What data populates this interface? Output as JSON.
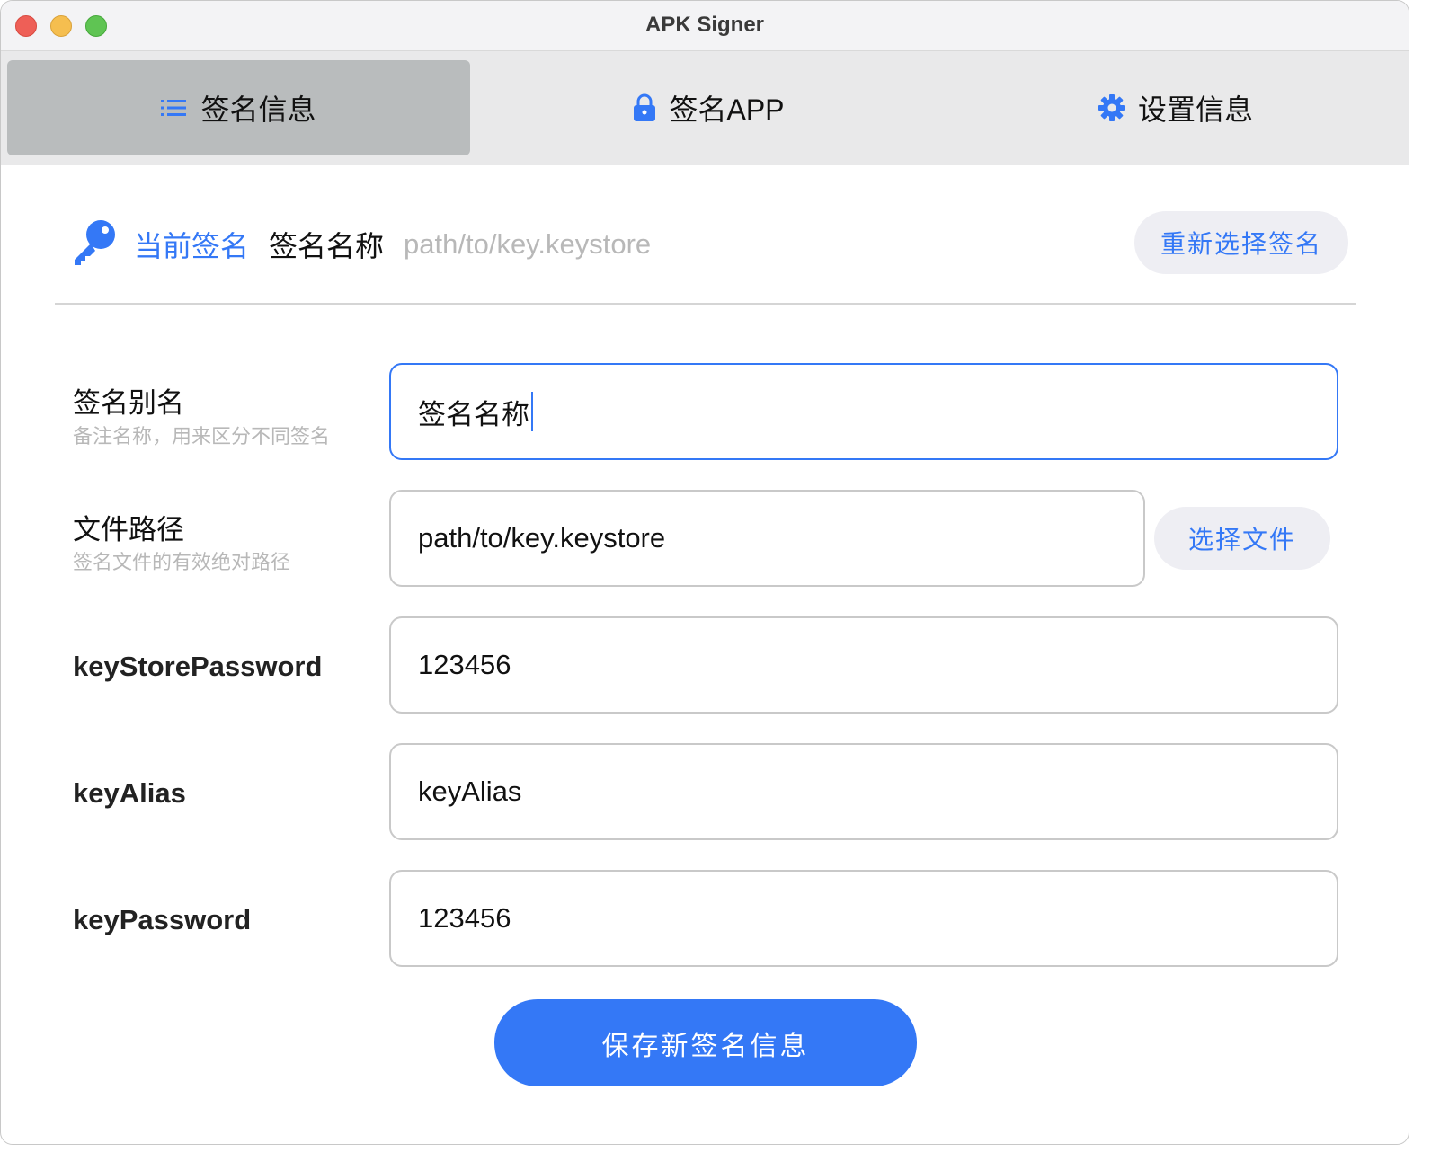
{
  "window": {
    "title": "APK Signer"
  },
  "tabs": [
    {
      "label": "签名信息",
      "icon": "list-icon",
      "active": true
    },
    {
      "label": "签名APP",
      "icon": "lock-icon",
      "active": false
    },
    {
      "label": "设置信息",
      "icon": "gear-icon",
      "active": false
    }
  ],
  "current": {
    "label": "当前签名",
    "name": "签名名称",
    "path": "path/to/key.keystore",
    "reselect_label": "重新选择签名"
  },
  "form": {
    "alias": {
      "label": "签名别名",
      "hint": "备注名称，用来区分不同签名",
      "value": "签名名称",
      "focused": true
    },
    "file": {
      "label": "文件路径",
      "hint": "签名文件的有效绝对路径",
      "value": "path/to/key.keystore",
      "button_label": "选择文件"
    },
    "keystore_password": {
      "label": "keyStorePassword",
      "value": "123456"
    },
    "key_alias": {
      "label": "keyAlias",
      "value": "keyAlias"
    },
    "key_password": {
      "label": "keyPassword",
      "value": "123456"
    }
  },
  "save_label": "保存新签名信息",
  "colors": {
    "accent": "#3478f6",
    "tab_active_bg": "#b9bcbd",
    "tab_bar_bg": "#e9e9ea",
    "hint_text": "#b8b8b8"
  }
}
